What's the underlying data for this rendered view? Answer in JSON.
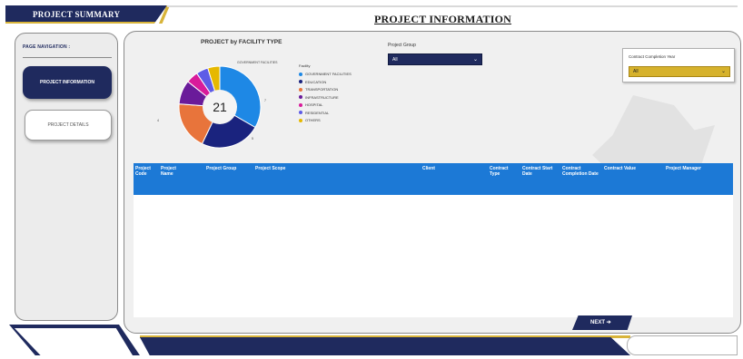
{
  "app": {
    "banner_title": "PROJECT SUMMARY",
    "page_title": "PROJECT INFORMATION"
  },
  "nav": {
    "title": "PAGE NAVIGATION :",
    "items": [
      {
        "label": "PROJECT INFORMATION",
        "active": true
      },
      {
        "label": "PROJECT DETAILS",
        "active": false
      }
    ]
  },
  "chart_data": {
    "type": "pie",
    "title": "PROJECT by FACILITY TYPE",
    "center_value": "21",
    "legend_title": "Facility",
    "legend": [
      {
        "label": "GOVERNMENT FACILITIES",
        "color": "#1e88e5"
      },
      {
        "label": "EDUCATION",
        "color": "#1a237e"
      },
      {
        "label": "TRANSPORTATION",
        "color": "#e8743b"
      },
      {
        "label": "INFRASTRUCTURE",
        "color": "#6a1b9a"
      },
      {
        "label": "HOSPITAL",
        "color": "#d81b9a"
      },
      {
        "label": "RESIDENTIAL",
        "color": "#5e5ce6"
      },
      {
        "label": "OTHERS",
        "color": "#e6b800"
      }
    ],
    "slices": [
      {
        "label": "GOVERNMENT FACILITIES",
        "value": 7,
        "color": "#1e88e5"
      },
      {
        "label": "EDUCATION",
        "value": 5,
        "color": "#1a237e"
      },
      {
        "label": "TRANSPORTATION",
        "value": 4,
        "color": "#e8743b"
      },
      {
        "label": "INFRASTRUCTURE",
        "value": 2,
        "color": "#6a1b9a"
      },
      {
        "label": "HOSPITAL",
        "value": 1,
        "color": "#d81b9a"
      },
      {
        "label": "RESIDENTIAL",
        "value": 1,
        "color": "#5e5ce6"
      },
      {
        "label": "OTHERS",
        "value": 1,
        "color": "#e6b800"
      }
    ]
  },
  "filters": {
    "project_group_label": "Project Group",
    "project_group_value": "All",
    "year_label": "Contract Completion Year",
    "year_value": "All"
  },
  "table": {
    "columns": [
      "Project Code",
      "Project Name",
      "Project Group",
      "Project Scope",
      "Client",
      "Contract Type",
      "Contract Start Date",
      "Contract Completion Date",
      "Contract Value",
      "Project Manager"
    ],
    "rows": []
  },
  "buttons": {
    "next": "NEXT ➔"
  },
  "colors": {
    "navy": "#1f2a5e",
    "accent_blue": "#1c79d6",
    "gold": "#d8b43a"
  }
}
